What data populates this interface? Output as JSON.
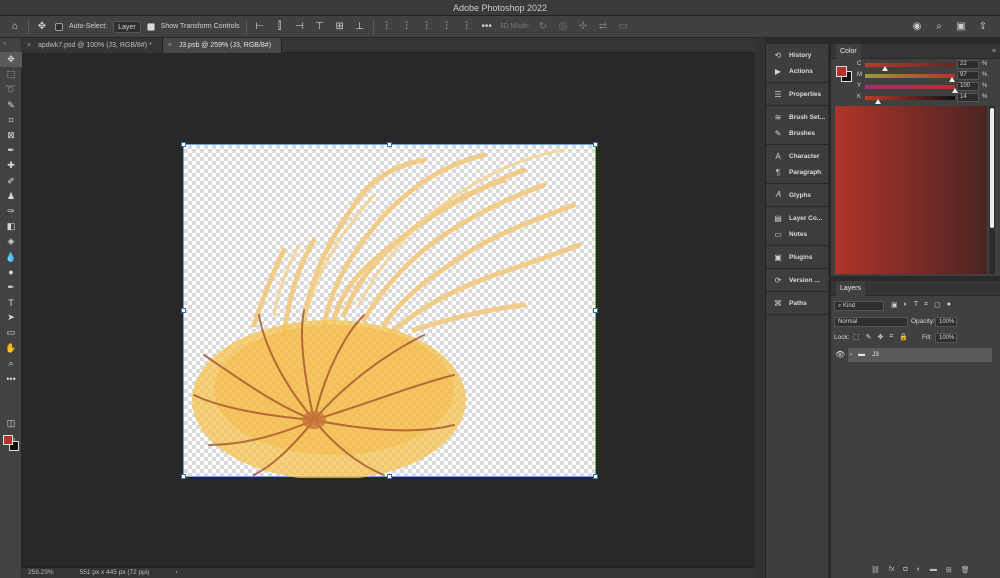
{
  "window": {
    "title": "Adobe Photoshop 2022"
  },
  "options_bar": {
    "auto_select_label": "Auto-Select:",
    "auto_select_target": "Layer",
    "show_transform_label": "Show Transform Controls",
    "mode_3d_label": "3D Mode:"
  },
  "tabs": [
    {
      "label": "apdwk7.psd @ 100% (J3, RGB/8#) *"
    },
    {
      "label": "J3.psb @ 259% (J3, RGB/8#)"
    }
  ],
  "status": {
    "zoom": "259.23%",
    "doc_size": "551 px x 445 px (72 ppi)"
  },
  "dock": {
    "groups": [
      [
        {
          "icon": "history-icon",
          "glyph": "⟲",
          "label": "History"
        },
        {
          "icon": "actions-icon",
          "glyph": "▶",
          "label": "Actions"
        }
      ],
      [
        {
          "icon": "properties-icon",
          "glyph": "☰",
          "label": "Properties"
        }
      ],
      [
        {
          "icon": "brush-settings-icon",
          "glyph": "≋",
          "label": "Brush Set..."
        },
        {
          "icon": "brushes-icon",
          "glyph": "✎",
          "label": "Brushes"
        }
      ],
      [
        {
          "icon": "character-icon",
          "glyph": "A",
          "label": "Character"
        },
        {
          "icon": "paragraph-icon",
          "glyph": "¶",
          "label": "Paragraph"
        }
      ],
      [
        {
          "icon": "glyphs-icon",
          "glyph": "𝐴",
          "label": "Glyphs"
        }
      ],
      [
        {
          "icon": "layer-comps-icon",
          "glyph": "▤",
          "label": "Layer Co..."
        },
        {
          "icon": "notes-icon",
          "glyph": "▭",
          "label": "Notes"
        }
      ],
      [
        {
          "icon": "plugins-icon",
          "glyph": "▣",
          "label": "Plugins"
        }
      ],
      [
        {
          "icon": "version-history-icon",
          "glyph": "⟳",
          "label": "Version ..."
        }
      ],
      [
        {
          "icon": "paths-icon",
          "glyph": "⌘",
          "label": "Paths"
        }
      ]
    ]
  },
  "color_panel": {
    "title": "Color",
    "sliders": [
      {
        "label": "C",
        "value": "22",
        "unit": "%",
        "pos": 0.22,
        "gradient": "linear-gradient(to right,#c0392b,#5c2a2a)"
      },
      {
        "label": "M",
        "value": "97",
        "unit": "%",
        "pos": 0.97,
        "gradient": "linear-gradient(to right,#9a9a3a,#b5322a)"
      },
      {
        "label": "Y",
        "value": "100",
        "unit": "%",
        "pos": 1.0,
        "gradient": "linear-gradient(to right,#a03070,#b5322a)"
      },
      {
        "label": "K",
        "value": "14",
        "unit": "%",
        "pos": 0.14,
        "gradient": "linear-gradient(to right,#c0392b,#111111)"
      }
    ],
    "fg_color": "#b5322a",
    "bg_color": "#111111"
  },
  "layers_panel": {
    "title": "Layers",
    "filter_kind": "Kind",
    "blend_mode": "Normal",
    "opacity_label": "Opacity:",
    "opacity_value": "100%",
    "lock_label": "Lock:",
    "fill_label": "Fill:",
    "fill_value": "100%",
    "layers": [
      {
        "name": "J3",
        "type": "group"
      }
    ]
  }
}
